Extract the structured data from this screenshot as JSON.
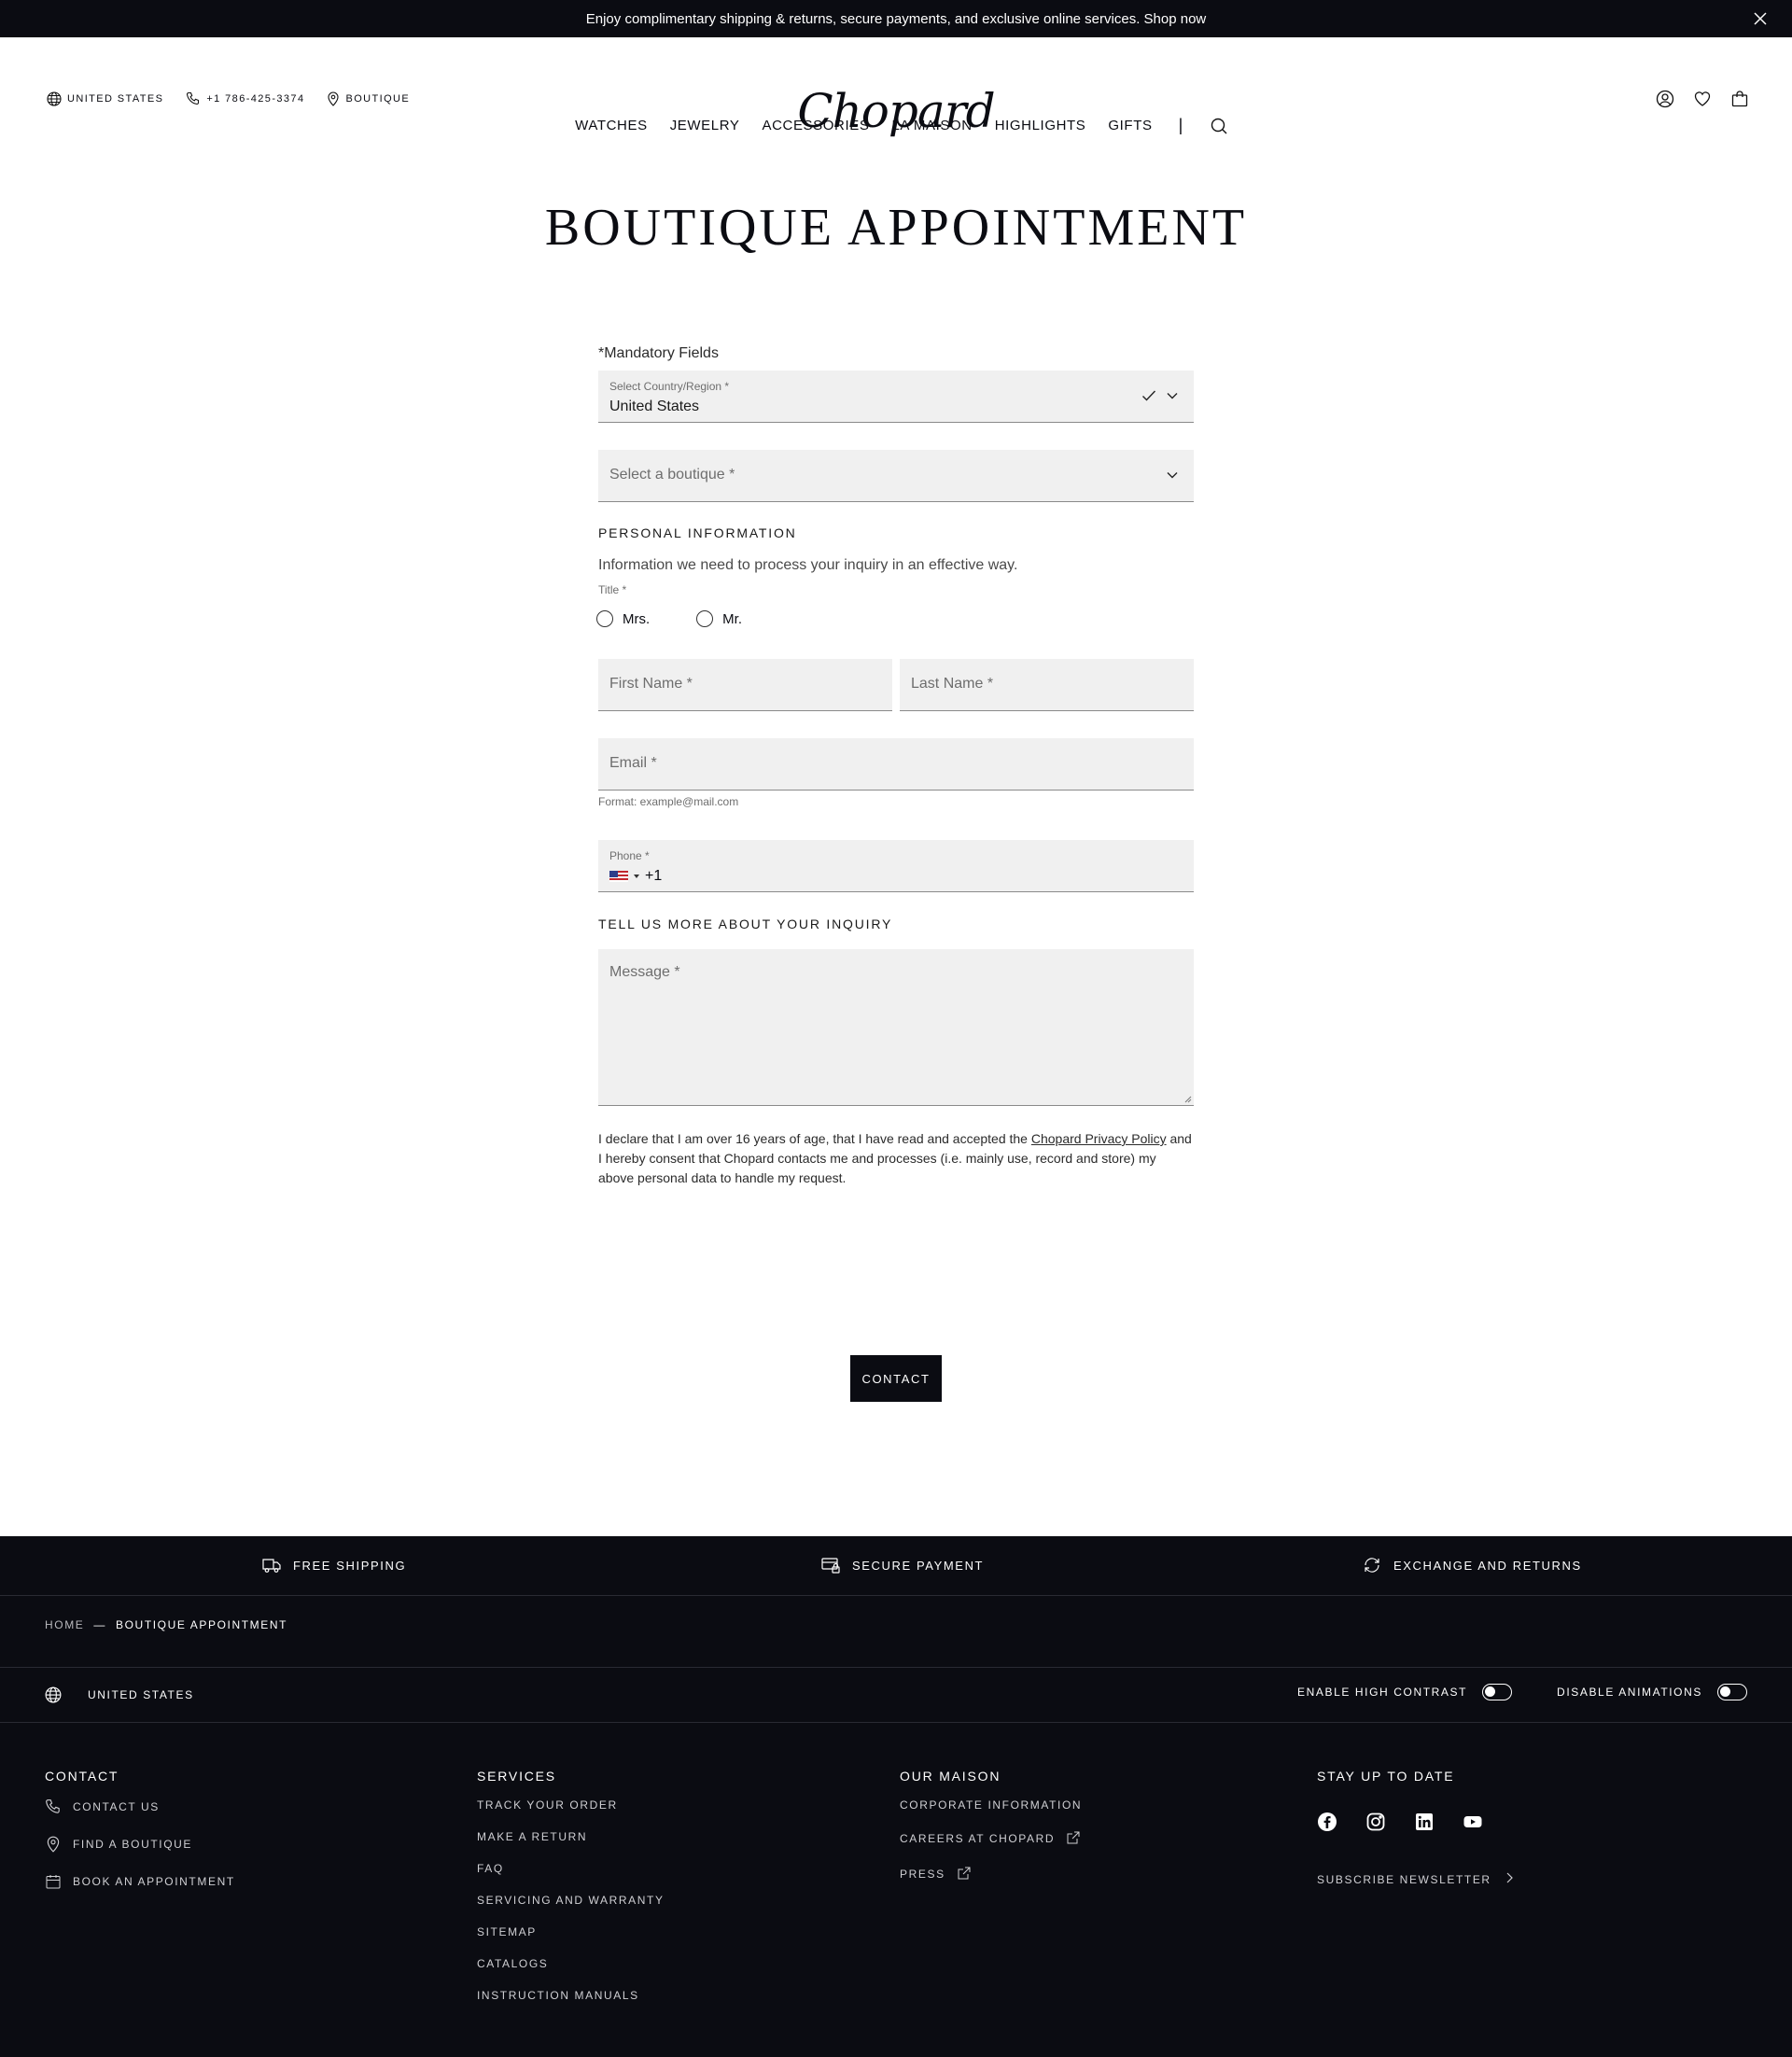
{
  "announcement": {
    "text": "Enjoy complimentary shipping & returns, secure payments, and exclusive online services. Shop now"
  },
  "header": {
    "country": "United States",
    "phone": "+1 786-425-3374",
    "boutique": "Boutique",
    "logo": "Chopard"
  },
  "nav": {
    "items": [
      "WATCHES",
      "JEWELRY",
      "ACCESSORIES",
      "LA MAISON",
      "HIGHLIGHTS",
      "GIFTS"
    ],
    "separator": "|"
  },
  "page": {
    "title": "BOUTIQUE APPOINTMENT"
  },
  "form": {
    "mandatory": "*Mandatory Fields",
    "country": {
      "label": "Select Country/Region *",
      "value": "United States"
    },
    "boutique": {
      "placeholder": "Select a boutique *"
    },
    "personal_heading": "Personal Information",
    "personal_help": "Information we need to process your inquiry in an effective way.",
    "title_label": "Title *",
    "title_options": [
      "Mrs.",
      "Mr."
    ],
    "first_name": {
      "placeholder": "First Name *"
    },
    "last_name": {
      "placeholder": "Last Name *"
    },
    "email": {
      "placeholder": "Email *",
      "hint": "Format: example@mail.com"
    },
    "phone": {
      "label": "Phone *",
      "code": "+1"
    },
    "inquiry_heading": "Tell us more about your inquiry",
    "message": {
      "placeholder": "Message *"
    },
    "consent_before": "I declare that I am over 16 years of age, that I have read and accepted the ",
    "consent_link": "Chopard Privacy Policy",
    "consent_after": " and I hereby consent that Chopard contacts me and processes (i.e. mainly use, record and store) my above personal data to handle my request.",
    "submit": "Contact"
  },
  "footer": {
    "services_strip": [
      "Free Shipping",
      "Secure Payment",
      "Exchange and Returns"
    ],
    "breadcrumb": {
      "home": "Home",
      "separator": "—",
      "current": "Boutique Appointment"
    },
    "locale": "United States",
    "toggles": [
      "Enable High Contrast",
      "Disable Animations"
    ],
    "contact": {
      "heading": "Contact",
      "links": [
        "Contact us",
        "Find a boutique",
        "Book an appointment"
      ]
    },
    "services": {
      "heading": "Services",
      "links": [
        "Track your order",
        "Make a return",
        "FAQ",
        "Servicing and Warranty",
        "Sitemap",
        "Catalogs",
        "Instruction Manuals"
      ]
    },
    "maison": {
      "heading": "Our Maison",
      "links": [
        "Corporate Information",
        "Careers at Chopard",
        "Press"
      ]
    },
    "stay": {
      "heading": "Stay up to date",
      "newsletter": "Subscribe Newsletter"
    }
  },
  "colors": {
    "dark": "#0b0c12",
    "field_bg": "#f0f0f0",
    "white": "#ffffff"
  }
}
